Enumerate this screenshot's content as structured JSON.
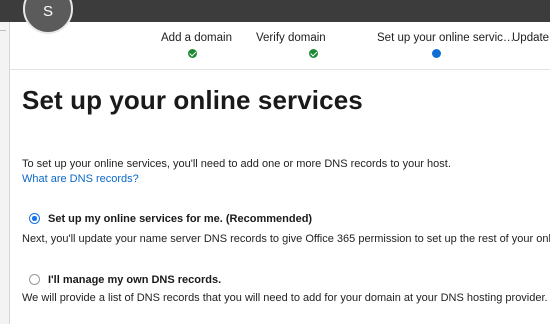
{
  "header": {
    "avatar_initial": "S"
  },
  "steps": [
    {
      "label": "Add a domain",
      "state": "complete"
    },
    {
      "label": "Verify domain",
      "state": "complete"
    },
    {
      "label": "Set up your online servic…",
      "state": "current"
    },
    {
      "label": "Update D",
      "state": "pending"
    }
  ],
  "main": {
    "title": "Set up your online services",
    "intro": "To set up your online services, you'll need to add one or more DNS records to your host.",
    "help_link": "What are DNS records?",
    "options": [
      {
        "label": "Set up my online services for me. (Recommended)",
        "description": "Next, you'll update your name server DNS records to give Office 365 permission to set up the rest of your online se",
        "selected": true
      },
      {
        "label": "I'll manage my own DNS records.",
        "description": "We will provide a list of DNS records that you will need to add for your domain at your DNS hosting provider.",
        "selected": false
      }
    ]
  },
  "colors": {
    "step_complete": "#1b8a32",
    "step_current": "#0f6fd6",
    "link": "#0b68c8",
    "radio_selected": "#1a73e8",
    "topbar": "#3c3c3c"
  }
}
